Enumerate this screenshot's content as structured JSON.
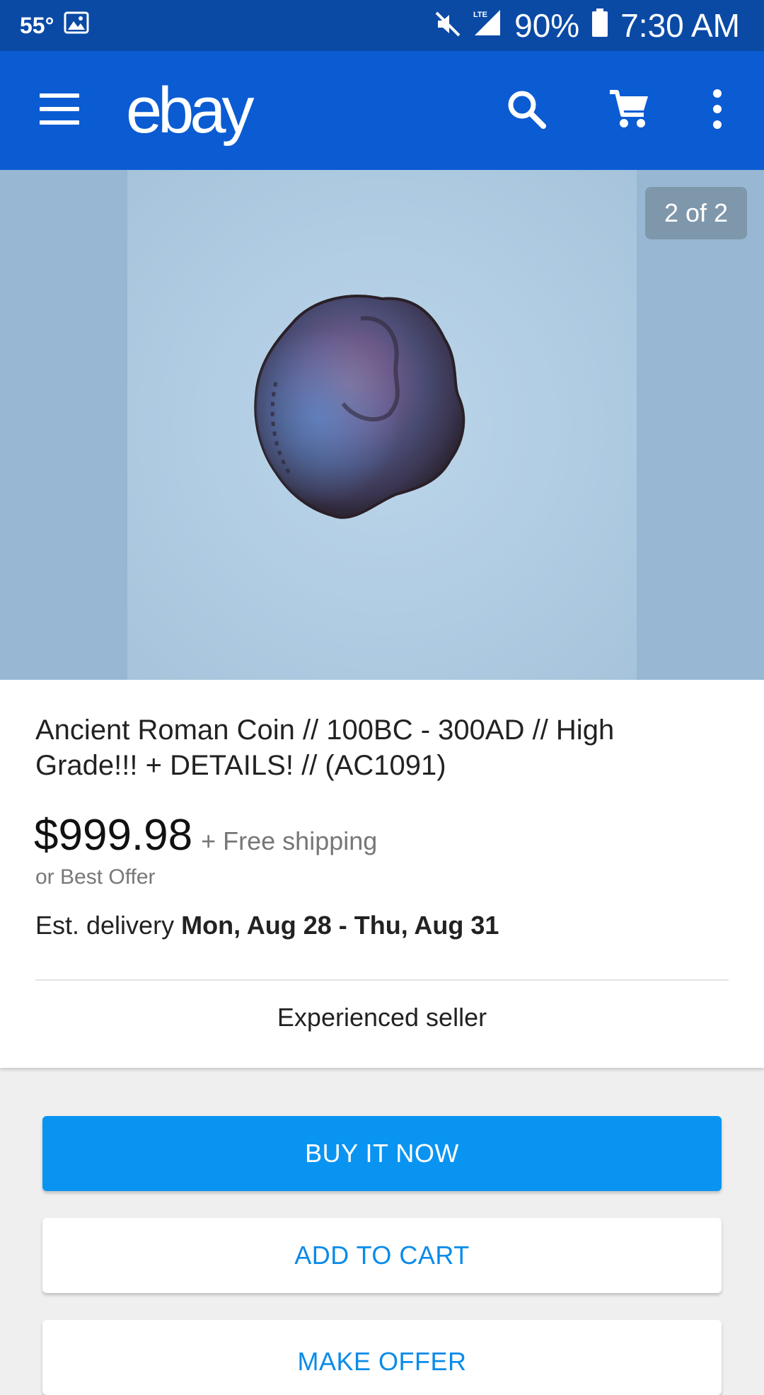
{
  "status_bar": {
    "temperature": "55°",
    "battery": "90%",
    "time": "7:30 AM",
    "network": "LTE"
  },
  "app_bar": {
    "logo": "ebay",
    "icons": [
      "menu-icon",
      "search-icon",
      "cart-icon",
      "more-vert-icon"
    ]
  },
  "gallery": {
    "counter": "2 of 2"
  },
  "listing": {
    "title": "Ancient Roman Coin // 100BC - 300AD // High Grade!!! + DETAILS! // (AC1091)",
    "price": "$999.98",
    "shipping": "+ Free shipping",
    "best_offer": "or Best Offer",
    "delivery_label": "Est. delivery",
    "delivery_dates": "Mon, Aug 28 - Thu, Aug 31",
    "seller": "Experienced seller"
  },
  "actions": {
    "buy_now": "BUY IT NOW",
    "add_to_cart": "ADD TO CART",
    "make_offer": "MAKE OFFER"
  },
  "colors": {
    "status_bar": "#0a4aa5",
    "app_bar": "#0b5bd3",
    "primary_button": "#0a94f2",
    "link_blue": "#0a8be8"
  }
}
